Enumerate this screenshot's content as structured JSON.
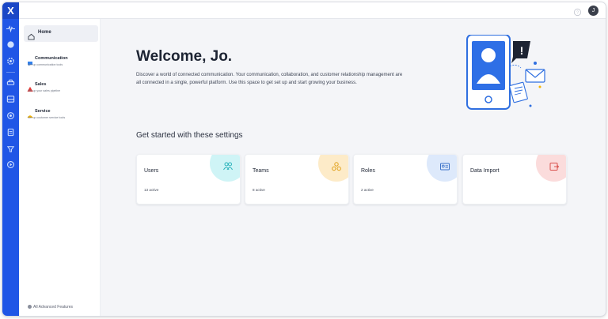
{
  "app": {
    "logo_text": "X"
  },
  "rail": {
    "icons": [
      "pulse-icon",
      "globe-icon",
      "gear-icon",
      "car-icon",
      "inbox-icon",
      "target-icon",
      "document-icon",
      "funnel-icon",
      "play-circle-icon"
    ]
  },
  "topbar": {
    "avatar_initial": "J"
  },
  "sidenav": {
    "home_label": "Home",
    "groups": [
      {
        "title": "Communication",
        "subtitle": "Set up communication tools",
        "color": "#2f80ed"
      },
      {
        "title": "Sales",
        "subtitle": "Set up your sales pipeline",
        "color": "#e53935"
      },
      {
        "title": "Service",
        "subtitle": "Set up customer service tools",
        "color": "#f5b400"
      }
    ],
    "footer_label": "All Advanced Features"
  },
  "main": {
    "title": "Welcome, Jo.",
    "intro": "Discover a world of connected communication. Your communication, collaboration, and customer relationship management are all connected in a single, powerful platform. Use this space to get set up and start growing your business.",
    "section_title": "Get started with these settings",
    "cards": [
      {
        "title": "Users",
        "meta": "13 active",
        "icon": "users-icon",
        "blob": "#cff4f6",
        "icon_color": "#2bb3bb"
      },
      {
        "title": "Teams",
        "meta": "8 active",
        "icon": "teams-icon",
        "blob": "#fdebc8",
        "icon_color": "#e0a11a"
      },
      {
        "title": "Roles",
        "meta": "2 active",
        "icon": "roles-icon",
        "blob": "#dde9fb",
        "icon_color": "#3d74c9"
      },
      {
        "title": "Data Import",
        "meta": "",
        "icon": "data-import-icon",
        "blob": "#fbdcdc",
        "icon_color": "#d9534f"
      }
    ]
  }
}
